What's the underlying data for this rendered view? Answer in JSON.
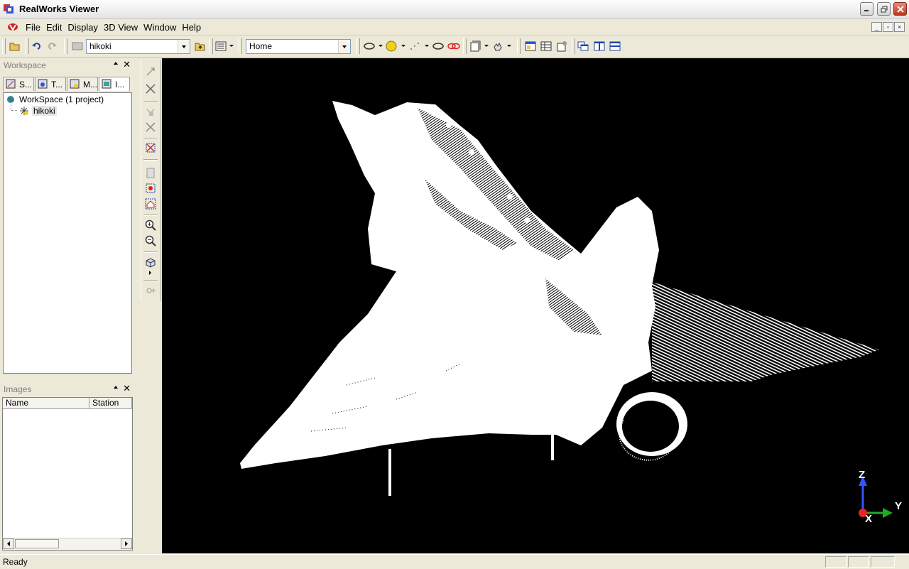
{
  "window": {
    "title": "RealWorks Viewer"
  },
  "menu": [
    "File",
    "Edit",
    "Display",
    "3D View",
    "Window",
    "Help"
  ],
  "toolbar": {
    "project_combo": "hikoki",
    "view_combo": "Home"
  },
  "workspace_panel": {
    "title": "Workspace",
    "tabs": [
      "S...",
      "T...",
      "M...",
      "I..."
    ],
    "tree_root": "WorkSpace (1 project)",
    "tree_child": "hikoki"
  },
  "images_panel": {
    "title": "Images",
    "columns": [
      "Name",
      "Station"
    ]
  },
  "axes": {
    "z": "Z",
    "y": "Y",
    "x": "X"
  },
  "status": {
    "text": "Ready"
  },
  "colors": {
    "viewport_bg": "#000000",
    "point_cloud": "#ffffff",
    "ui_bg": "#ece9d8"
  }
}
